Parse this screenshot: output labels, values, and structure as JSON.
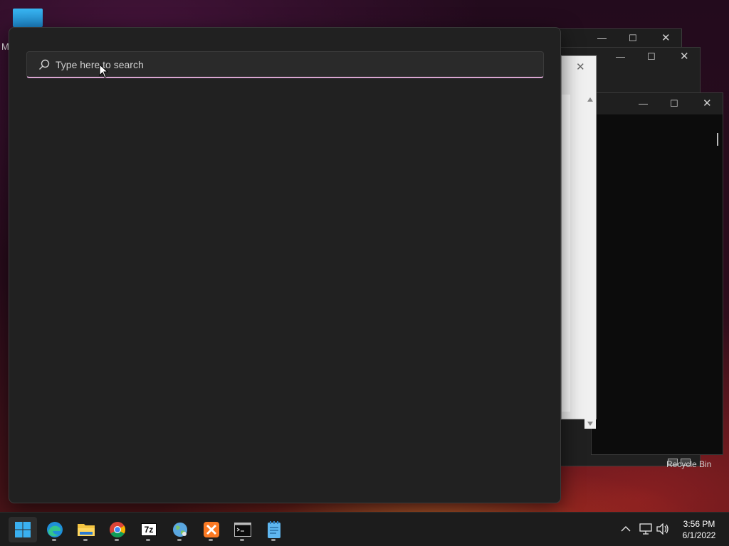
{
  "desktop": {
    "left_label": "M",
    "recycle_bin_label": "Recycle Bin"
  },
  "search": {
    "placeholder": "Type here to search",
    "value": ""
  },
  "taskbar": {
    "apps": [
      {
        "name": "start",
        "icon": "windows-logo-icon"
      },
      {
        "name": "edge",
        "icon": "edge-icon"
      },
      {
        "name": "file-explorer",
        "icon": "folder-icon"
      },
      {
        "name": "chrome",
        "icon": "chrome-icon"
      },
      {
        "name": "7zip",
        "icon": "7zip-icon",
        "label": "7z"
      },
      {
        "name": "network-app",
        "icon": "globe-icon"
      },
      {
        "name": "xampp",
        "icon": "xampp-icon"
      },
      {
        "name": "terminal",
        "icon": "terminal-icon"
      },
      {
        "name": "notepad",
        "icon": "notepad-icon"
      }
    ],
    "tray": {
      "chevron": "chevron-up-icon",
      "network": "network-icon",
      "volume": "volume-icon"
    },
    "clock": {
      "time": "3:56 PM",
      "date": "6/1/2022"
    }
  },
  "colors": {
    "panel_bg": "#212121",
    "search_accent": "#d9a6d1",
    "taskbar_bg": "#1c1c1c"
  }
}
